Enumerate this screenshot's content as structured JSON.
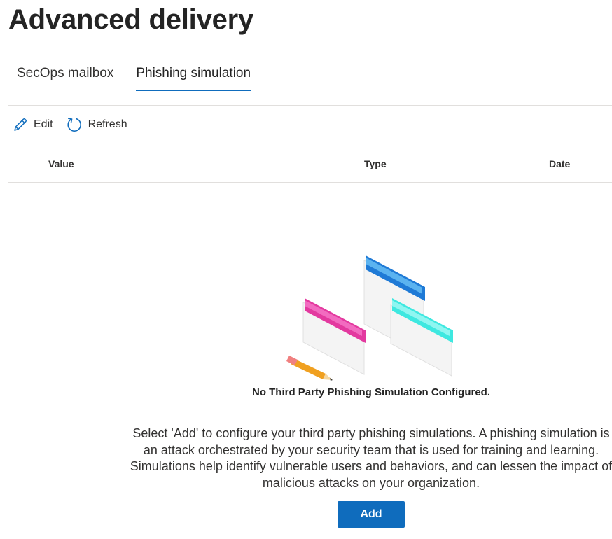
{
  "header": {
    "title": "Advanced delivery"
  },
  "tabs": [
    {
      "label": "SecOps mailbox",
      "active": false
    },
    {
      "label": "Phishing simulation",
      "active": true
    }
  ],
  "toolbar": {
    "edit_label": "Edit",
    "refresh_label": "Refresh",
    "edit_icon": "pencil-icon",
    "refresh_icon": "refresh-icon"
  },
  "table": {
    "columns": [
      "Value",
      "Type",
      "Date"
    ],
    "rows": []
  },
  "empty_state": {
    "title": "No Third Party Phishing Simulation Configured.",
    "description": "Select 'Add' to configure your third party phishing simulations. A phishing simulation is an attack orchestrated by your security team that is used for training and learning. Simulations help identify vulnerable users and behaviors, and can lessen the impact of malicious attacks on your organization.",
    "button_label": "Add"
  },
  "colors": {
    "accent": "#0f6cbd",
    "window_blue": "#1f7ad6",
    "window_pink": "#e3399f",
    "window_cyan": "#3ee8e0"
  }
}
